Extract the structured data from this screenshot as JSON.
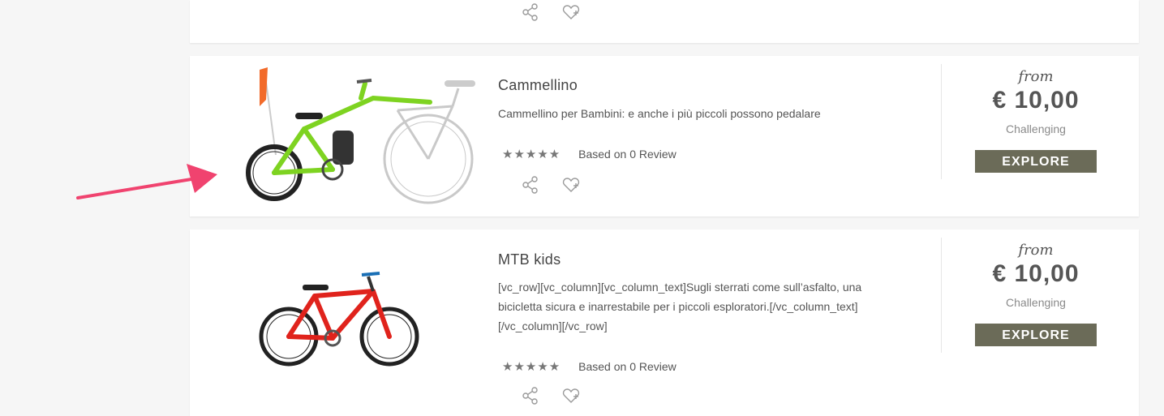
{
  "tours": [
    {
      "title": "Cammellino",
      "description": "Cammellino per Bambini: e anche i più piccoli possono pedalare",
      "stars": "★★★★★",
      "review_text": "Based on 0 Review",
      "from_label": "from",
      "price": "€ 10,00",
      "difficulty": "Challenging",
      "button_label": "EXPLORE"
    },
    {
      "title": "MTB kids",
      "description": "[vc_row][vc_column][vc_column_text]Sugli sterrati come sull’asfalto, una bicicletta sicura e inarrestabile per i piccoli esploratori.[/vc_column_text][/vc_column][/vc_row]",
      "stars": "★★★★★",
      "review_text": "Based on 0 Review",
      "from_label": "from",
      "price": "€ 10,00",
      "difficulty": "Challenging",
      "button_label": "EXPLORE"
    }
  ],
  "colors": {
    "button_bg": "#6b6b58",
    "arrow": "#f0436f",
    "bike_green": "#7ed321",
    "bike_red": "#e0231c"
  }
}
